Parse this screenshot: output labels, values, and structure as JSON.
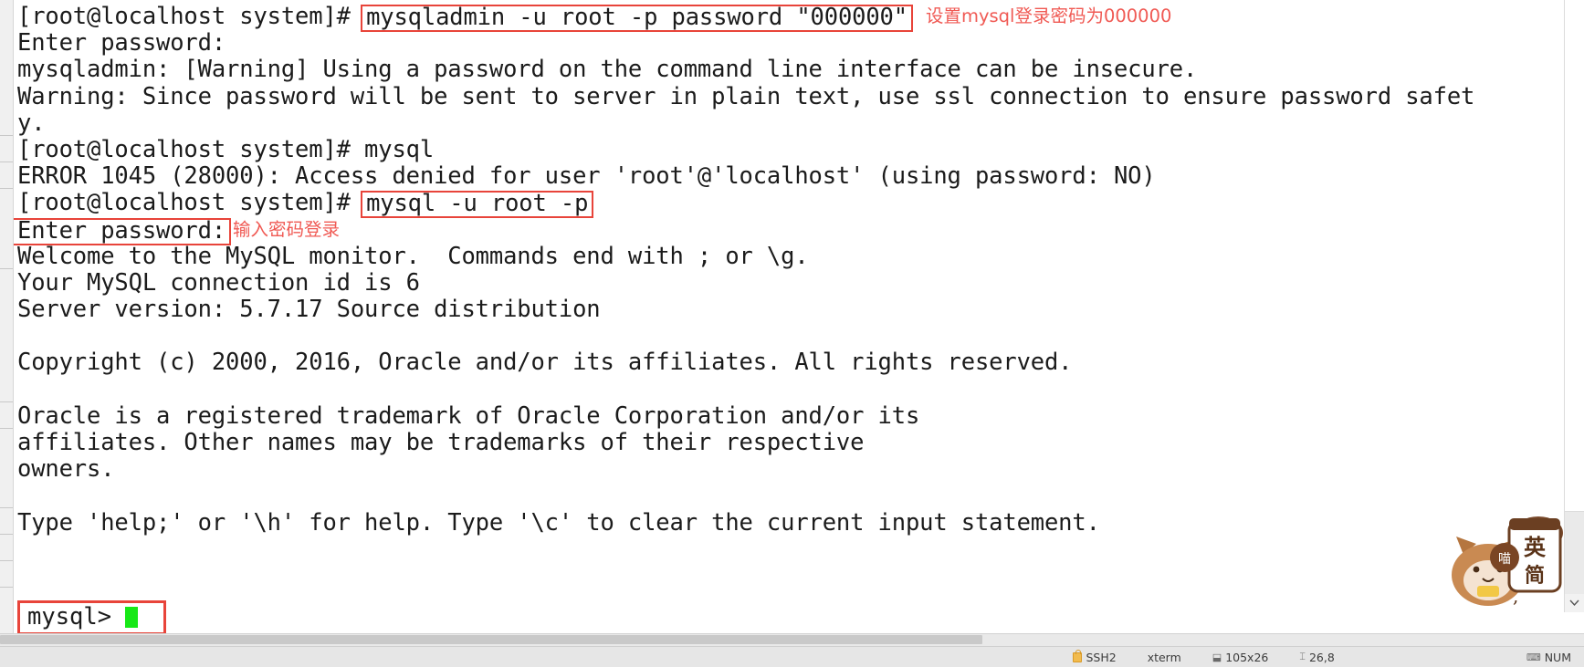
{
  "terminal": {
    "lines": [
      {
        "id": "l0",
        "text": "[root@localhost system]# ",
        "boxed": "mysqladmin -u root -p password \"000000\"",
        "annotation": "设置mysql登录密码为000000"
      },
      {
        "id": "l1",
        "text": "Enter password:"
      },
      {
        "id": "l2",
        "text": "mysqladmin: [Warning] Using a password on the command line interface can be insecure."
      },
      {
        "id": "l3",
        "text": "Warning: Since password will be sent to server in plain text, use ssl connection to ensure password safet"
      },
      {
        "id": "l4",
        "text": "y."
      },
      {
        "id": "l5",
        "text": "[root@localhost system]# mysql"
      },
      {
        "id": "l6",
        "text": "ERROR 1045 (28000): Access denied for user 'root'@'localhost' (using password: NO)"
      },
      {
        "id": "l7",
        "text": "[root@localhost system]# ",
        "boxed": "mysql -u root -p"
      },
      {
        "id": "l8",
        "text": "",
        "boxed": "Enter password:",
        "annotation": "输入密码登录"
      },
      {
        "id": "l9",
        "text": "Welcome to the MySQL monitor.  Commands end with ; or \\g."
      },
      {
        "id": "l10",
        "text": "Your MySQL connection id is 6"
      },
      {
        "id": "l11",
        "text": "Server version: 5.7.17 Source distribution"
      },
      {
        "id": "l12",
        "text": ""
      },
      {
        "id": "l13",
        "text": "Copyright (c) 2000, 2016, Oracle and/or its affiliates. All rights reserved."
      },
      {
        "id": "l14",
        "text": ""
      },
      {
        "id": "l15",
        "text": "Oracle is a registered trademark of Oracle Corporation and/or its"
      },
      {
        "id": "l16",
        "text": "affiliates. Other names may be trademarks of their respective"
      },
      {
        "id": "l17",
        "text": "owners."
      },
      {
        "id": "l18",
        "text": ""
      },
      {
        "id": "l19",
        "text": "Type 'help;' or '\\h' for help. Type '\\c' to clear the current input statement."
      },
      {
        "id": "l20",
        "text": ""
      }
    ],
    "prompt": "mysql> ",
    "cursor_color": "#17e817",
    "annotation_color": "#f05a54",
    "highlight_box_color": "#e8443a"
  },
  "statusbar": {
    "protocol": "SSH2",
    "emulation": "xterm",
    "size": "105x26",
    "position": "26,8",
    "indicator": "NUM"
  },
  "watermark": {
    "bubble_text": "喵",
    "brand_line1": "英",
    "brand_line2": "简"
  }
}
